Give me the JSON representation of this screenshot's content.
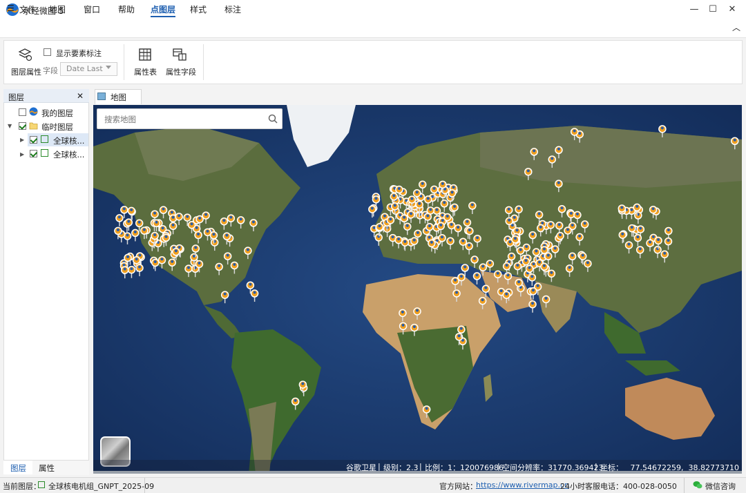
{
  "app": {
    "title": "水经微图 5",
    "accent": "#1e5fb0"
  },
  "window_controls": {
    "minimize": "—",
    "maximize": "☐",
    "close": "✕"
  },
  "menu": {
    "hamburger": "☰",
    "items": [
      "文件",
      "地图",
      "窗口",
      "帮助",
      "点图层",
      "样式",
      "标注"
    ],
    "active": "点图层",
    "collapse": "︿"
  },
  "ribbon": {
    "layer_props": "图层属性",
    "show_labels": "显示要素标注",
    "field_label": "字段",
    "field_value": "Date Last",
    "attr_table": "属性表",
    "attr_fields": "属性字段"
  },
  "layer_panel": {
    "title": "图层",
    "close": "✕",
    "items": [
      {
        "label": "我的图层",
        "checked": false
      },
      {
        "label": "临时图层",
        "checked": true
      },
      {
        "label": "全球核...",
        "checked": true
      },
      {
        "label": "全球核...",
        "checked": true
      }
    ],
    "tabs": [
      "图层",
      "属性"
    ]
  },
  "map_tab": {
    "label": "地图"
  },
  "search": {
    "placeholder": "搜索地图"
  },
  "map_status": {
    "source": "谷歌卫星",
    "level": "级别：2.3",
    "scale": "比例：1：120076986",
    "resolution": "空间分辨率：31770.369423",
    "coords": "坐标：   77.54672259,  38.82773710"
  },
  "statusbar": {
    "current_layer_label": "当前图层：",
    "current_layer": "全球核电机组_GNPT_2025-09",
    "website_label": "官方网站：",
    "website": "https://www.rivermap.cn",
    "hotline": "24小时客服电话：400-028-0050",
    "wechat": "微信咨询"
  },
  "colors": {
    "ocean": "#1d3e72",
    "land": "#556b3a",
    "desert": "#c9a06a",
    "ice": "#eef1f4",
    "marker": "#f0a020"
  }
}
